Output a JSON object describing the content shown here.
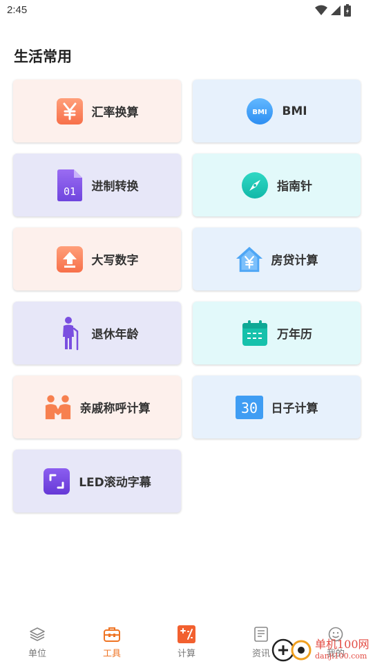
{
  "status": {
    "time": "2:45"
  },
  "section": {
    "title": "生活常用"
  },
  "tools": [
    {
      "label": "汇率换算",
      "icon": "yuan-exchange-icon"
    },
    {
      "label": "BMI",
      "icon": "bmi-icon",
      "icon_text": "BMI"
    },
    {
      "label": "进制转换",
      "icon": "binary-file-icon",
      "icon_text": "01"
    },
    {
      "label": "指南针",
      "icon": "compass-icon"
    },
    {
      "label": "大写数字",
      "icon": "uppercase-arrow-icon"
    },
    {
      "label": "房贷计算",
      "icon": "house-loan-icon"
    },
    {
      "label": "退休年龄",
      "icon": "elderly-person-icon"
    },
    {
      "label": "万年历",
      "icon": "calendar-icon"
    },
    {
      "label": "亲戚称呼计算",
      "icon": "family-icon"
    },
    {
      "label": "日子计算",
      "icon": "day-count-icon",
      "icon_text": "30"
    },
    {
      "label": "LED滚动字幕",
      "icon": "led-frame-icon"
    }
  ],
  "tabbar": {
    "items": [
      {
        "label": "单位",
        "icon": "layers-icon"
      },
      {
        "label": "工具",
        "icon": "toolbox-icon",
        "active": true
      },
      {
        "label": "计算",
        "icon": "calculator-icon"
      },
      {
        "label": "资讯",
        "icon": "news-icon"
      },
      {
        "label": "我的",
        "icon": "profile-icon"
      }
    ]
  },
  "watermark": {
    "text": "单机100网",
    "sub": "danji100.com"
  },
  "colors": {
    "accent": "#ef7424",
    "peach_card": "#fdf0ec",
    "sky_card": "#e7f1fc",
    "lavender_card": "#e7e7f8",
    "cyan_card": "#e2f9fa"
  }
}
